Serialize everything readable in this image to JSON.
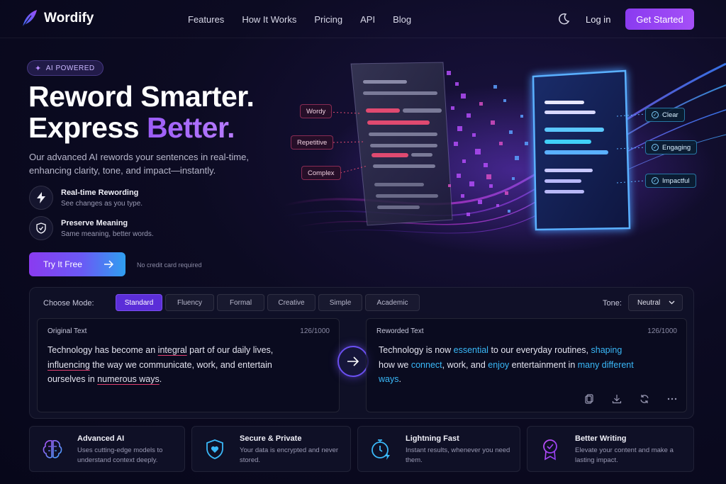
{
  "brand": {
    "name": "Wordify"
  },
  "nav": {
    "links": [
      "Features",
      "How It Works",
      "Pricing",
      "API",
      "Blog"
    ],
    "login": "Log in",
    "cta": "Get Started"
  },
  "hero": {
    "badge": "AI POWERED",
    "title_line1": "Reword Smarter.",
    "title_line2_a": "Express ",
    "title_line2_b": "Better.",
    "subtitle": "Our advanced AI rewords your sentences in real-time, enhancing clarity, tone, and impact—instantly.",
    "features": [
      {
        "title": "Real-time Rewording",
        "desc": "See changes as you type.",
        "icon": "lightning-icon"
      },
      {
        "title": "Preserve Meaning",
        "desc": "Same meaning, better words.",
        "icon": "shield-icon"
      }
    ],
    "try_button": "Try It Free",
    "no_card": "No credit card required",
    "tags_before": [
      "Wordy",
      "Repetitive",
      "Complex"
    ],
    "tags_after": [
      "Clear",
      "Engaging",
      "Impactful"
    ]
  },
  "editor": {
    "mode_label": "Choose Mode:",
    "modes": [
      "Standard",
      "Fluency",
      "Formal",
      "Creative",
      "Simple",
      "Academic"
    ],
    "active_mode": "Standard",
    "tone_label": "Tone:",
    "tone_value": "Neutral",
    "original": {
      "header": "Original Text",
      "count": "126/1000",
      "parts": [
        {
          "t": "Technology has become an ",
          "u": false
        },
        {
          "t": "integral",
          "u": true
        },
        {
          "t": " part of our daily lives, ",
          "u": false
        },
        {
          "t": "influencing",
          "u": true
        },
        {
          "t": " the way we communicate, work, and entertain ourselves in ",
          "u": false
        },
        {
          "t": "numerous ways",
          "u": true
        },
        {
          "t": ".",
          "u": false
        }
      ]
    },
    "reworded": {
      "header": "Reworded Text",
      "count": "126/1000",
      "parts": [
        {
          "t": "Technology is now ",
          "h": false
        },
        {
          "t": "essential",
          "h": true
        },
        {
          "t": " to our everyday routines, ",
          "h": false
        },
        {
          "t": "shaping",
          "h": true
        },
        {
          "t": " how we ",
          "h": false
        },
        {
          "t": "connect",
          "h": true
        },
        {
          "t": ", work, and ",
          "h": false
        },
        {
          "t": "enjoy",
          "h": true
        },
        {
          "t": " entertainment in ",
          "h": false
        },
        {
          "t": "many different ways",
          "h": true
        },
        {
          "t": ".",
          "h": false
        }
      ]
    },
    "tools": [
      "copy-icon",
      "download-icon",
      "refresh-icon",
      "more-icon"
    ]
  },
  "cards": [
    {
      "title": "Advanced AI",
      "desc": "Uses cutting-edge models to understand context deeply.",
      "icon": "brain-icon"
    },
    {
      "title": "Secure & Private",
      "desc": "Your data is encrypted and never stored.",
      "icon": "shield-heart-icon"
    },
    {
      "title": "Lightning Fast",
      "desc": "Instant results, whenever you need them.",
      "icon": "stopwatch-icon"
    },
    {
      "title": "Better Writing",
      "desc": "Elevate your content and make a lasting impact.",
      "icon": "award-icon"
    }
  ],
  "colors": {
    "accent_purple": "#8a3bf0",
    "accent_blue": "#3ab8f8",
    "underline_red": "#e04070"
  }
}
